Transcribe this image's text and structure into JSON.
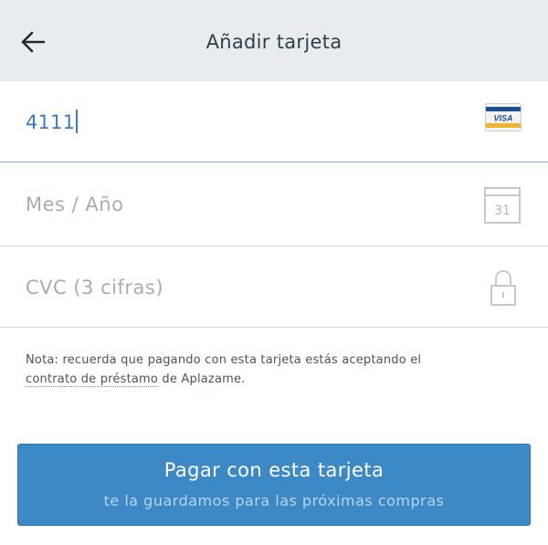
{
  "header": {
    "back_icon": "arrow-left-icon",
    "title": "Añadir tarjeta"
  },
  "form": {
    "card_number": {
      "value": "4111",
      "icon": "visa-card-icon",
      "icon_text": "VISA"
    },
    "expiry": {
      "placeholder": "Mes / Año",
      "icon": "calendar-icon",
      "icon_text": "31"
    },
    "cvc": {
      "placeholder": "CVC (3 cifras)",
      "icon": "lock-icon"
    }
  },
  "note": {
    "prefix": "Nota: recuerda que pagando con esta tarjeta estás aceptando el",
    "link": "contrato de préstamo",
    "suffix": " de Aplazame."
  },
  "pay_button": {
    "title": "Pagar con esta tarjeta",
    "subtitle": "te la guardamos para las próximas compras"
  },
  "colors": {
    "header_bg": "#e8ecef",
    "accent": "#3c89c5",
    "input_text": "#3a7dbe",
    "placeholder": "#a6adb2"
  }
}
